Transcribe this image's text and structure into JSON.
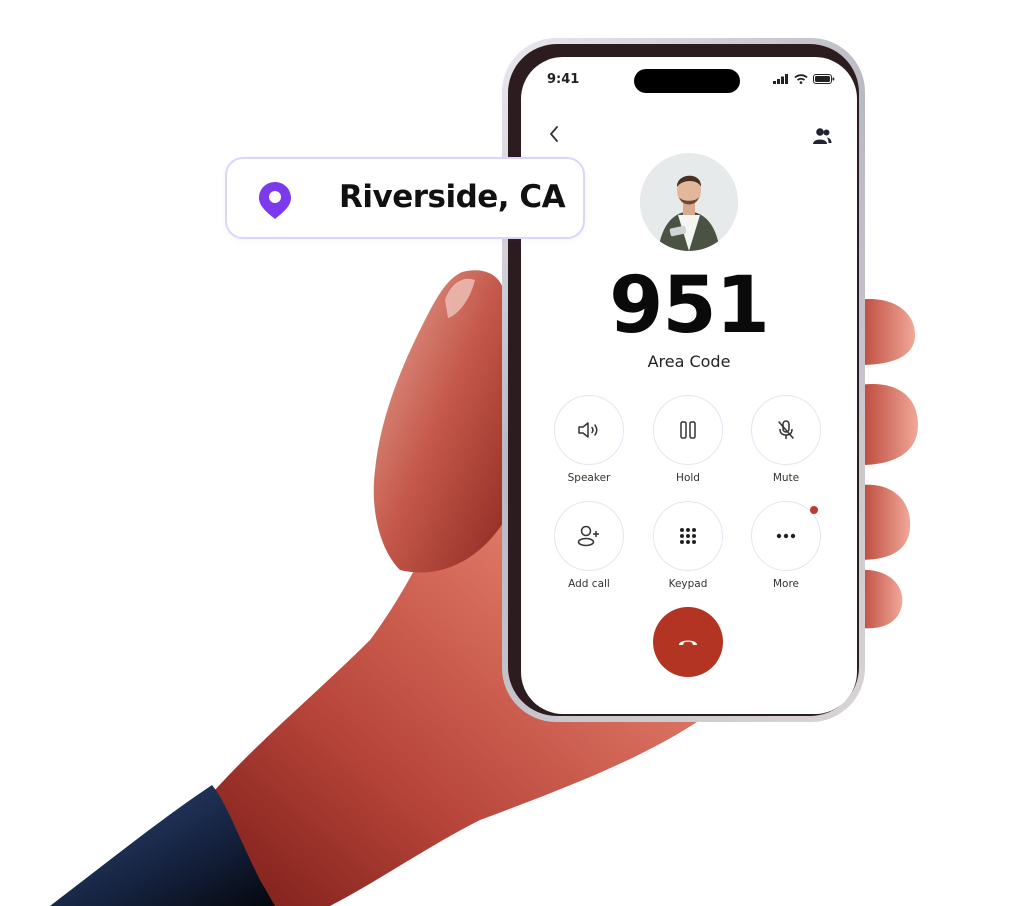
{
  "location": {
    "icon": "map-pin-icon",
    "text": "Riverside, CA",
    "accent_color": "#7c3aed"
  },
  "phone": {
    "status_bar": {
      "time": "9:41",
      "icons": [
        "signal-icon",
        "wifi-icon",
        "battery-icon"
      ]
    },
    "nav": {
      "back_icon": "chevron-left-icon",
      "contacts_icon": "contacts-icon"
    },
    "caller": {
      "avatar": "caller-photo",
      "number": "951",
      "label": "Area Code"
    },
    "controls": [
      {
        "label": "Speaker",
        "icon": "speaker-icon"
      },
      {
        "label": "Hold",
        "icon": "pause-icon"
      },
      {
        "label": "Mute",
        "icon": "mic-off-icon"
      },
      {
        "label": "Add call",
        "icon": "add-person-icon"
      },
      {
        "label": "Keypad",
        "icon": "keypad-icon"
      },
      {
        "label": "More",
        "icon": "more-icon",
        "badge": true
      }
    ],
    "end_call": {
      "icon": "hang-up-icon",
      "color": "#b43423"
    }
  }
}
